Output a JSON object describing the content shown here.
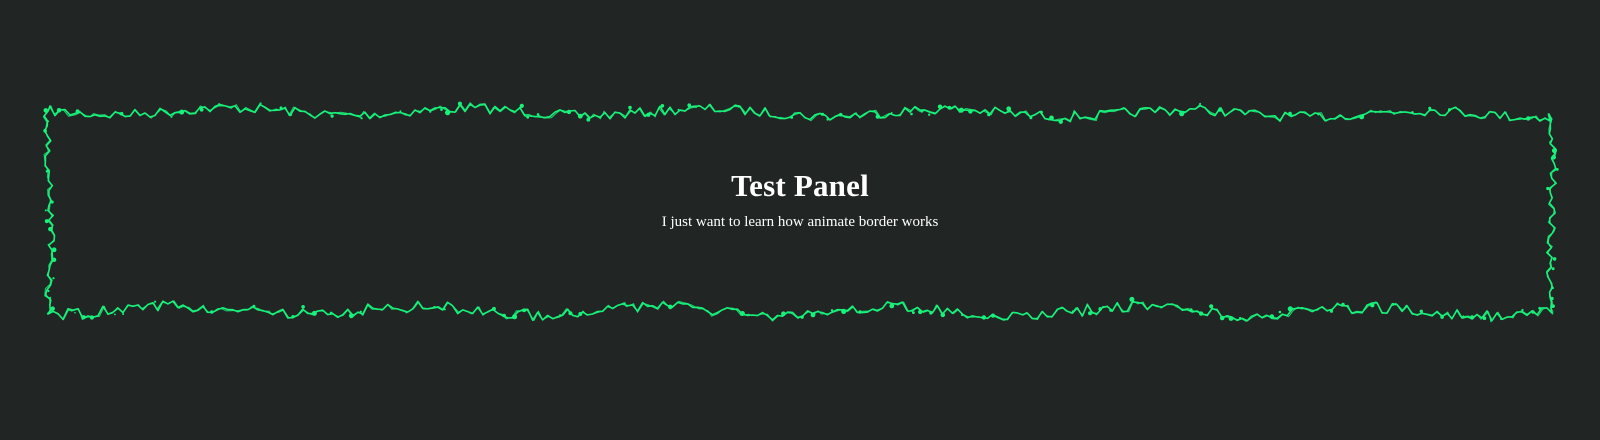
{
  "panel": {
    "title": "Test Panel",
    "subtitle": "I just want to learn how animate border works"
  },
  "theme": {
    "background": "#212625",
    "border_color": "#19f27a",
    "text_color": "#ffffff"
  }
}
